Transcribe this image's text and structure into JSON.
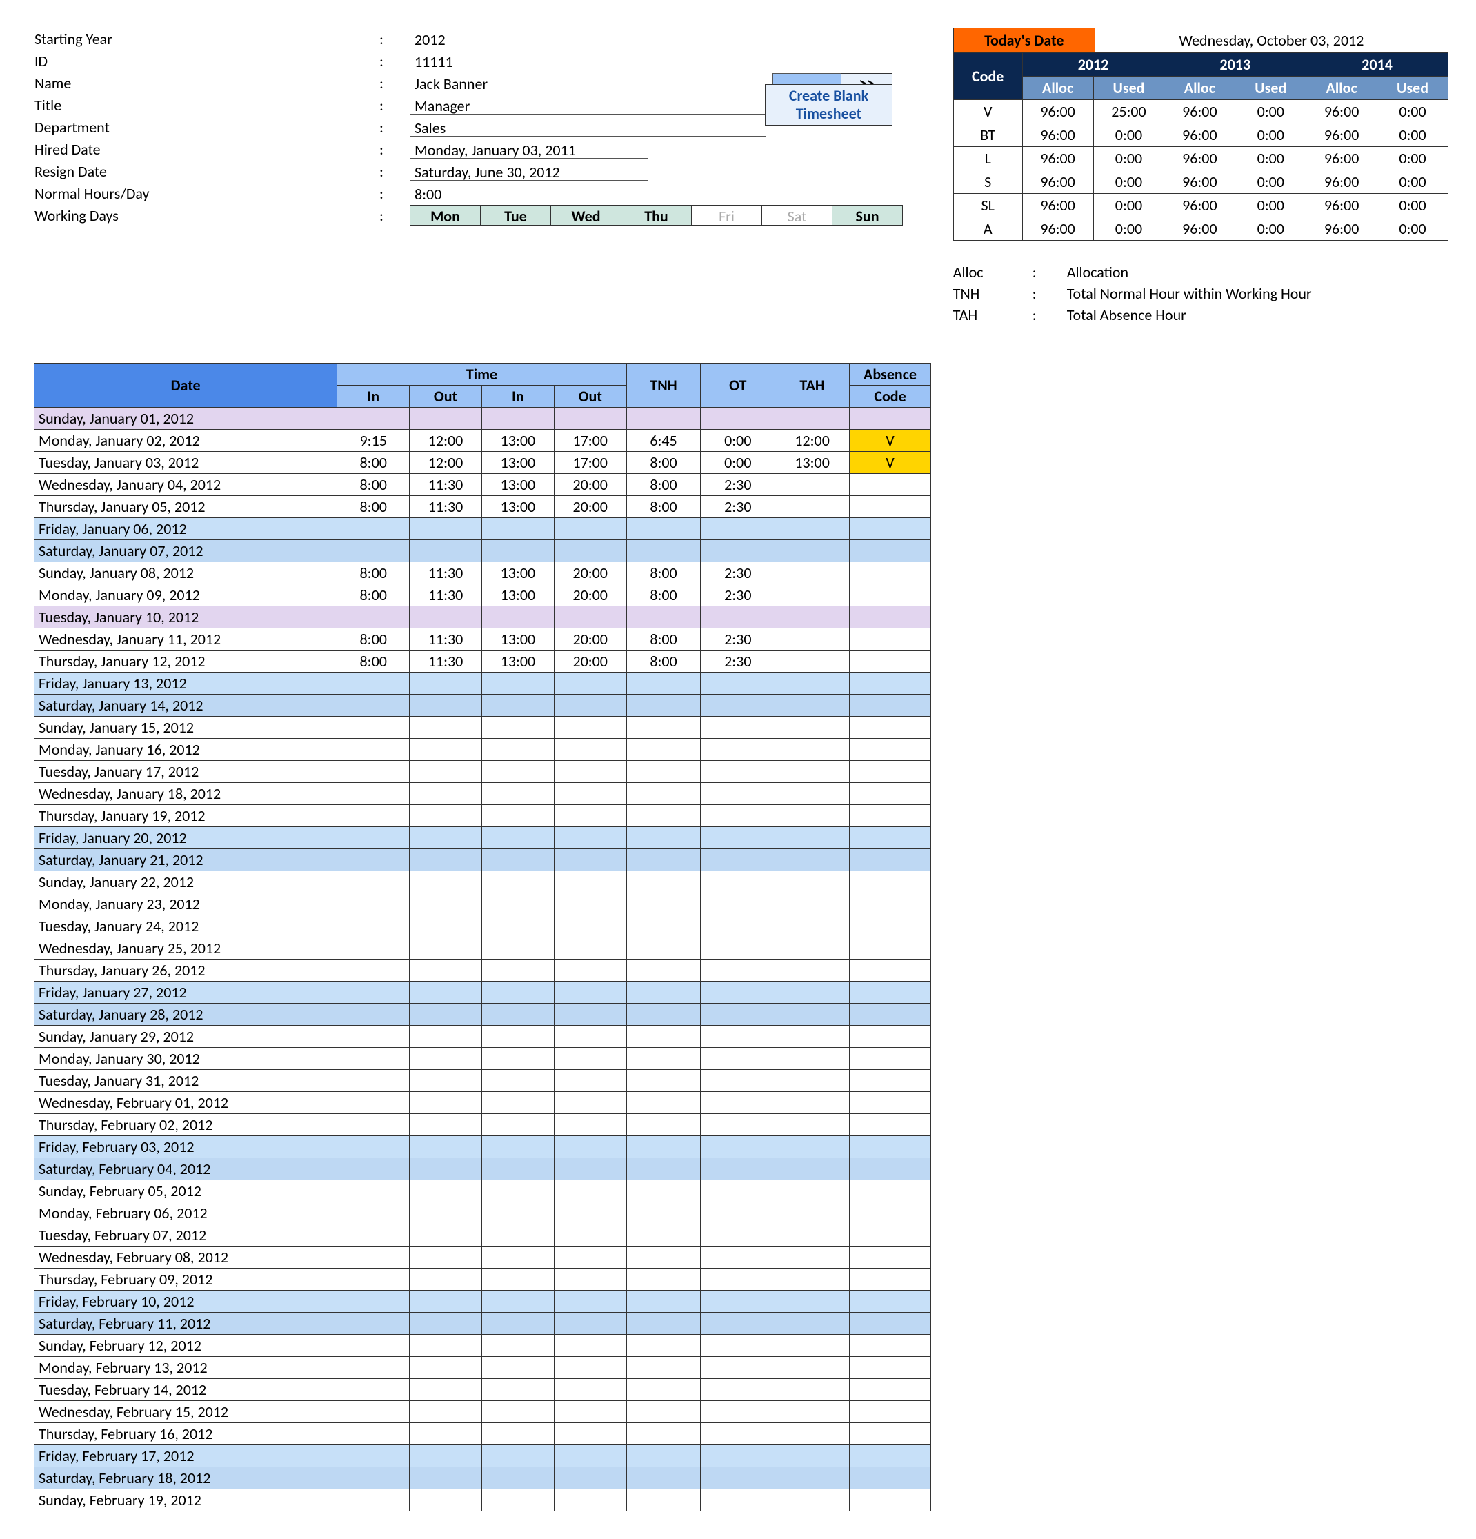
{
  "today": {
    "label": "Today's Date",
    "value": "Wednesday, October 03, 2012"
  },
  "codes": {
    "header_code": "Code",
    "years": [
      "2012",
      "2013",
      "2014"
    ],
    "sub": [
      "Alloc",
      "Used"
    ],
    "rows": [
      {
        "c": "V",
        "v": [
          "96:00",
          "25:00",
          "96:00",
          "0:00",
          "96:00",
          "0:00"
        ]
      },
      {
        "c": "BT",
        "v": [
          "96:00",
          "0:00",
          "96:00",
          "0:00",
          "96:00",
          "0:00"
        ]
      },
      {
        "c": "L",
        "v": [
          "96:00",
          "0:00",
          "96:00",
          "0:00",
          "96:00",
          "0:00"
        ]
      },
      {
        "c": "S",
        "v": [
          "96:00",
          "0:00",
          "96:00",
          "0:00",
          "96:00",
          "0:00"
        ]
      },
      {
        "c": "SL",
        "v": [
          "96:00",
          "0:00",
          "96:00",
          "0:00",
          "96:00",
          "0:00"
        ]
      },
      {
        "c": "A",
        "v": [
          "96:00",
          "0:00",
          "96:00",
          "0:00",
          "96:00",
          "0:00"
        ]
      }
    ]
  },
  "legend": [
    {
      "k": "Alloc",
      "v": "Allocation"
    },
    {
      "k": "TNH",
      "v": "Total Normal Hour within Working Hour"
    },
    {
      "k": "TAH",
      "v": "Total Absence Hour"
    }
  ],
  "info": {
    "fields": [
      {
        "l": "Starting Year",
        "v": "2012",
        "w": 0
      },
      {
        "l": "ID",
        "v": "11111",
        "w": 0
      },
      {
        "l": "Name",
        "v": "Jack Banner",
        "w": 1,
        "name": 1
      },
      {
        "l": "Title",
        "v": "Manager",
        "w": 1,
        "btn": 1
      },
      {
        "l": "Department",
        "v": "Sales",
        "w": 1,
        "btn": 2
      },
      {
        "l": "Hired Date",
        "v": "Monday, January 03, 2011",
        "w": 0
      },
      {
        "l": "Resign Date",
        "v": "Saturday, June 30, 2012",
        "w": 0
      },
      {
        "l": "Normal Hours/Day",
        "v": "8:00",
        "w": 0,
        "nb": 1
      },
      {
        "l": "Working Days",
        "v": "",
        "days": 1
      }
    ],
    "go": ">>",
    "blank1": "Create Blank",
    "blank2": "Timesheet",
    "days": [
      {
        "l": "Mon",
        "on": 1
      },
      {
        "l": "Tue",
        "on": 1
      },
      {
        "l": "Wed",
        "on": 1
      },
      {
        "l": "Thu",
        "on": 1
      },
      {
        "l": "Fri",
        "on": 0
      },
      {
        "l": "Sat",
        "on": 0
      },
      {
        "l": "Sun",
        "on": 1
      }
    ]
  },
  "sheet": {
    "h_date": "Date",
    "h_time": "Time",
    "h_in": "In",
    "h_out": "Out",
    "h_tnh": "TNH",
    "h_ot": "OT",
    "h_tah": "TAH",
    "h_abs1": "Absence",
    "h_abs2": "Code",
    "rows": [
      {
        "d": "Sunday, January 01, 2012",
        "t": "sun"
      },
      {
        "d": "Monday, January 02, 2012",
        "v": [
          "9:15",
          "12:00",
          "13:00",
          "17:00",
          "6:45",
          "0:00",
          "12:00"
        ],
        "a": "V"
      },
      {
        "d": "Tuesday, January 03, 2012",
        "v": [
          "8:00",
          "12:00",
          "13:00",
          "17:00",
          "8:00",
          "0:00",
          "13:00"
        ],
        "a": "V"
      },
      {
        "d": "Wednesday, January 04, 2012",
        "v": [
          "8:00",
          "11:30",
          "13:00",
          "20:00",
          "8:00",
          "2:30",
          "",
          ""
        ]
      },
      {
        "d": "Thursday, January 05, 2012",
        "v": [
          "8:00",
          "11:30",
          "13:00",
          "20:00",
          "8:00",
          "2:30",
          "",
          ""
        ]
      },
      {
        "d": "Friday, January 06, 2012",
        "t": "fri"
      },
      {
        "d": "Saturday, January 07, 2012",
        "t": "sat"
      },
      {
        "d": "Sunday, January 08, 2012",
        "v": [
          "8:00",
          "11:30",
          "13:00",
          "20:00",
          "8:00",
          "2:30",
          "",
          ""
        ]
      },
      {
        "d": "Monday, January 09, 2012",
        "v": [
          "8:00",
          "11:30",
          "13:00",
          "20:00",
          "8:00",
          "2:30",
          "",
          ""
        ]
      },
      {
        "d": "Tuesday, January 10, 2012",
        "t": "sun"
      },
      {
        "d": "Wednesday, January 11, 2012",
        "v": [
          "8:00",
          "11:30",
          "13:00",
          "20:00",
          "8:00",
          "2:30",
          "",
          ""
        ]
      },
      {
        "d": "Thursday, January 12, 2012",
        "v": [
          "8:00",
          "11:30",
          "13:00",
          "20:00",
          "8:00",
          "2:30",
          "",
          ""
        ]
      },
      {
        "d": "Friday, January 13, 2012",
        "t": "fri"
      },
      {
        "d": "Saturday, January 14, 2012",
        "t": "sat"
      },
      {
        "d": "Sunday, January 15, 2012"
      },
      {
        "d": "Monday, January 16, 2012"
      },
      {
        "d": "Tuesday, January 17, 2012"
      },
      {
        "d": "Wednesday, January 18, 2012"
      },
      {
        "d": "Thursday, January 19, 2012"
      },
      {
        "d": "Friday, January 20, 2012",
        "t": "fri"
      },
      {
        "d": "Saturday, January 21, 2012",
        "t": "sat"
      },
      {
        "d": "Sunday, January 22, 2012"
      },
      {
        "d": "Monday, January 23, 2012"
      },
      {
        "d": "Tuesday, January 24, 2012"
      },
      {
        "d": "Wednesday, January 25, 2012"
      },
      {
        "d": "Thursday, January 26, 2012"
      },
      {
        "d": "Friday, January 27, 2012",
        "t": "fri"
      },
      {
        "d": "Saturday, January 28, 2012",
        "t": "sat"
      },
      {
        "d": "Sunday, January 29, 2012"
      },
      {
        "d": "Monday, January 30, 2012"
      },
      {
        "d": "Tuesday, January 31, 2012"
      },
      {
        "d": "Wednesday, February 01, 2012"
      },
      {
        "d": "Thursday, February 02, 2012"
      },
      {
        "d": "Friday, February 03, 2012",
        "t": "fri"
      },
      {
        "d": "Saturday, February 04, 2012",
        "t": "sat"
      },
      {
        "d": "Sunday, February 05, 2012"
      },
      {
        "d": "Monday, February 06, 2012"
      },
      {
        "d": "Tuesday, February 07, 2012"
      },
      {
        "d": "Wednesday, February 08, 2012"
      },
      {
        "d": "Thursday, February 09, 2012"
      },
      {
        "d": "Friday, February 10, 2012",
        "t": "fri"
      },
      {
        "d": "Saturday, February 11, 2012",
        "t": "sat"
      },
      {
        "d": "Sunday, February 12, 2012"
      },
      {
        "d": "Monday, February 13, 2012"
      },
      {
        "d": "Tuesday, February 14, 2012"
      },
      {
        "d": "Wednesday, February 15, 2012"
      },
      {
        "d": "Thursday, February 16, 2012"
      },
      {
        "d": "Friday, February 17, 2012",
        "t": "fri"
      },
      {
        "d": "Saturday, February 18, 2012",
        "t": "sat"
      },
      {
        "d": "Sunday, February 19, 2012"
      }
    ]
  }
}
